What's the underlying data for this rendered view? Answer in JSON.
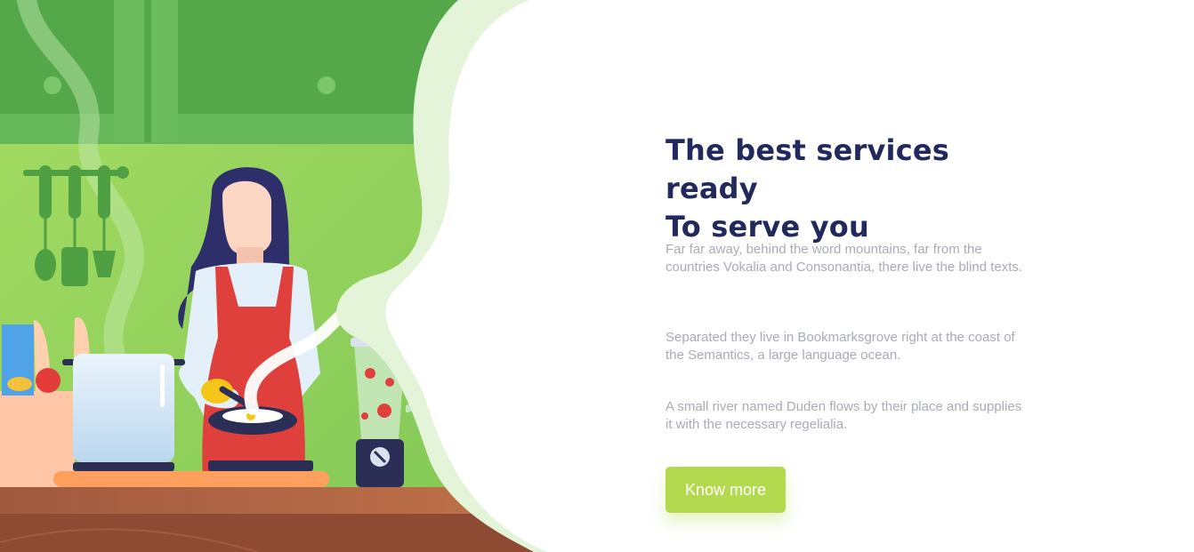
{
  "hero": {
    "title_line1": "The best services ready",
    "title_line2": "To serve you",
    "paragraphs": [
      "Far far away, behind the word mountains, far from the countries Vokalia and Consonantia, there live the blind texts.",
      "Separated they live in Bookmarksgrove right at the coast of the Semantics, a large language ocean.",
      "A small river named Duden flows by their place and supplies it with the necessary regelialia."
    ],
    "cta_label": "Know more"
  },
  "illustration": {
    "subject": "woman-cooking-in-kitchen",
    "colors": {
      "wall": "#8fd05c",
      "cabinet": "#55a84a",
      "counter": "#a0603d",
      "apron": "#e0403c",
      "accent": "#b3d94f"
    }
  }
}
